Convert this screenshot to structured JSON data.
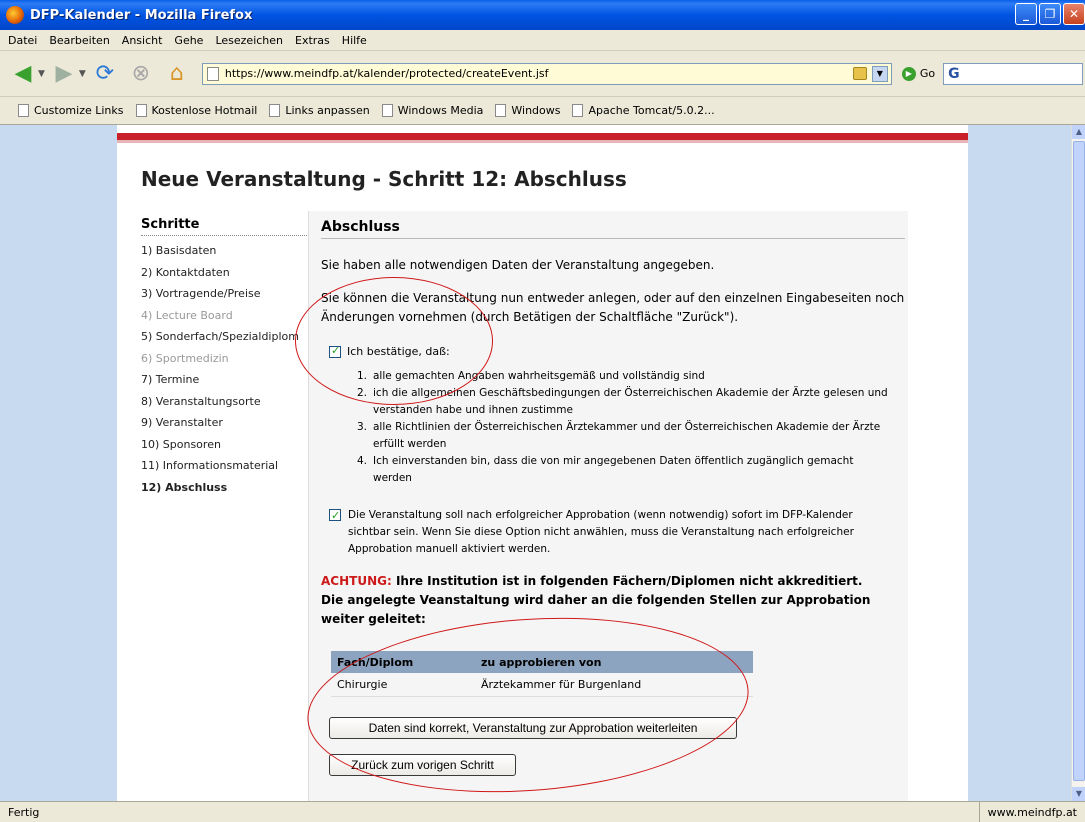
{
  "window": {
    "title": "DFP-Kalender - Mozilla Firefox",
    "buttons": {
      "minimize": "_",
      "maximize": "❐",
      "close": "✕"
    }
  },
  "menu": [
    "Datei",
    "Bearbeiten",
    "Ansicht",
    "Gehe",
    "Lesezeichen",
    "Extras",
    "Hilfe"
  ],
  "navbar": {
    "url": "https://www.meindfp.at/kalender/protected/createEvent.jsf",
    "go_label": "Go",
    "search_logo": "G"
  },
  "bookmarks": [
    "Customize Links",
    "Kostenlose Hotmail",
    "Links anpassen",
    "Windows Media",
    "Windows",
    "Apache Tomcat/5.0.2..."
  ],
  "page": {
    "title": "Neue Veranstaltung - Schritt 12: Abschluss",
    "sidebar": {
      "title": "Schritte",
      "steps": [
        {
          "label": "1) Basisdaten",
          "state": "normal"
        },
        {
          "label": "2) Kontaktdaten",
          "state": "normal"
        },
        {
          "label": "3) Vortragende/Preise",
          "state": "normal"
        },
        {
          "label": "4) Lecture Board",
          "state": "disabled"
        },
        {
          "label": "5) Sonderfach/Spezialdiplom",
          "state": "normal"
        },
        {
          "label": "6) Sportmedizin",
          "state": "disabled"
        },
        {
          "label": "7) Termine",
          "state": "normal"
        },
        {
          "label": "8) Veranstaltungsorte",
          "state": "normal"
        },
        {
          "label": "9) Veranstalter",
          "state": "normal"
        },
        {
          "label": "10) Sponsoren",
          "state": "normal"
        },
        {
          "label": "11) Informationsmaterial",
          "state": "normal"
        },
        {
          "label": "12) Abschluss",
          "state": "current"
        }
      ]
    },
    "main": {
      "section_title": "Abschluss",
      "p1": "Sie haben alle notwendigen Daten der Veranstaltung angegeben.",
      "p2": "Sie können die Veranstaltung nun entweder anlegen, oder auf den einzelnen Eingabeseiten noch Änderungen vornehmen (durch Betätigen der Schaltfläche \"Zurück\").",
      "confirm_label": "Ich bestätige, daß:",
      "confirm_checked": true,
      "list": [
        {
          "num": "1.",
          "text": "alle gemachten Angaben wahrheitsgemäß und vollständig sind"
        },
        {
          "num": "2.",
          "text": "ich die allgemeinen Geschäftsbedingungen der Österreichischen Akademie der Ärzte gelesen und verstanden habe und ihnen zustimme"
        },
        {
          "num": "3.",
          "text": "alle Richtlinien der Österreichischen Ärztekammer und der Österreichischen Akademie der Ärzte erfüllt werden"
        },
        {
          "num": "4.",
          "text": "Ich einverstanden bin, dass die von mir angegebenen Daten öffentlich zugänglich gemacht werden"
        }
      ],
      "publish_label": "Die Veranstaltung soll nach erfolgreicher Approbation (wenn notwendig) sofort im DFP-Kalender sichtbar sein. Wenn Sie diese Option nicht anwählen, muss die Veranstaltung nach erfolgreicher Approbation manuell aktiviert werden.",
      "publish_checked": true,
      "warning_prefix": "ACHTUNG:",
      "warning_line1": " Ihre Institution ist in folgenden Fächern/Diplomen nicht akkreditiert.",
      "warning_line2": "Die angelegte Veanstaltung wird daher an die folgenden Stellen zur Approbation weiter geleitet:",
      "table": {
        "headers": [
          "Fach/Diplom",
          "zu approbieren von"
        ],
        "rows": [
          [
            "Chirurgie",
            "Ärztekammer für Burgenland"
          ]
        ]
      },
      "submit_label": "Daten sind korrekt, Veranstaltung zur Approbation weiterleiten",
      "back_label": "Zurück zum vorigen Schritt"
    }
  },
  "status": {
    "left": "Fertig",
    "right": "www.meindfp.at"
  }
}
